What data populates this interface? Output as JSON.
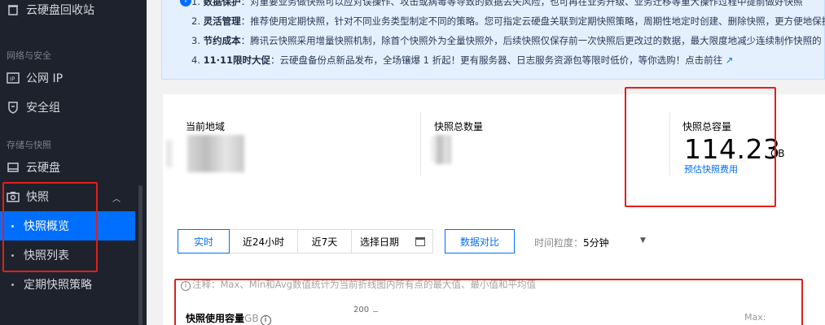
{
  "sidebar": {
    "recycle_bin": "云硬盘回收站",
    "group_network": "网络与安全",
    "public_ip": "公网 IP",
    "security_group": "安全组",
    "group_storage": "存储与快照",
    "cloud_disk": "云硬盘",
    "snapshot": "快照",
    "snapshot_overview": "快照概览",
    "snapshot_list": "快照列表",
    "scheduled_policy": "定期快照策略"
  },
  "tips": {
    "line1": "对重要业务做快照可以应对误操作、攻击或病毒等导致的数据丢失风险，也可再在业务升级、业务迁移等重大操作过程中提前做好快照",
    "line1_prefix": "1. ",
    "line1_title": "数据保护",
    "line2_prefix": "2. ",
    "line2_title": "灵活管理",
    "line2": "：推荐使用定期快照，针对不同业务类型制定不同的策略。您可指定云硬盘关联到定期快照策略，周期性地定时创建、删除快照，更方便地保护",
    "line3_prefix": "3. ",
    "line3_title": "节约成本",
    "line3": "：腾讯云快照采用增量快照机制，除首个快照外为全量快照外，后续快照仅保存前一次快照后更改过的数据，最大限度地减少连续制作快照的",
    "line4_prefix": "4. ",
    "line4_title": "11·11限时大促",
    "line4": "：云硬盘备份点新品发布，全场镶爆 1 折起！更有服务器、日志服务资源包等限时低价，等你选购！点击前往",
    "link_icon": "↗"
  },
  "stats": {
    "region_label": "当前地域",
    "count_label": "快照总数量",
    "capacity_label": "快照总容量",
    "capacity_value": "114.23",
    "capacity_unit": "GB",
    "estimate_link": "预估快照费用"
  },
  "toolbar": {
    "realtime": "实时",
    "last24h": "近24小时",
    "last7d": "近7天",
    "select_date": "选择日期",
    "compare": "数据对比",
    "granularity_label": "时间粒度：",
    "granularity_value": "5分钟"
  },
  "note": "注释：Max、Min和Avg数值统计为当前折线图内所有点的最大值、最小值和平均值",
  "chart": {
    "title": "快照使用容量",
    "unit": "GB",
    "y_tick": "200",
    "max_label": "Max:"
  },
  "colors": {
    "sidebar_bg": "#1e222d",
    "accent": "#006eff",
    "annotation_red": "#e0201b"
  }
}
